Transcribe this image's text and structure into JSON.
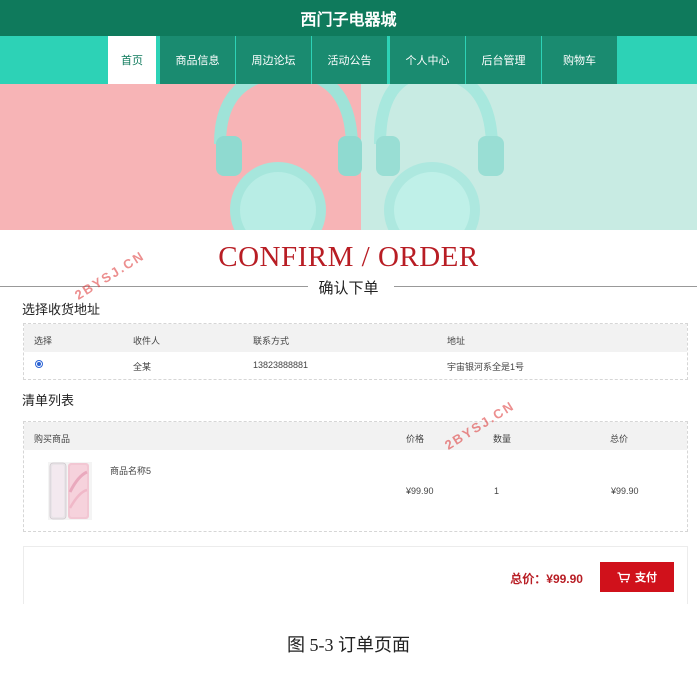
{
  "site_title": "西门子电器城",
  "nav": {
    "home": "首页",
    "products": "商品信息",
    "forum": "周边论坛",
    "announcements": "活动公告",
    "profile": "个人中心",
    "admin": "后台管理",
    "cart": "购物车"
  },
  "page_heading": {
    "title_en": "CONFIRM / ORDER",
    "title_cn": "确认下单"
  },
  "address_section": {
    "title": "选择收货地址",
    "headers": {
      "select": "选择",
      "recipient": "收件人",
      "contact": "联系方式",
      "address": "地址"
    },
    "row": {
      "recipient": "全某",
      "contact": "13823888881",
      "address": "宇宙银河系全是1号"
    }
  },
  "order_list": {
    "title": "清单列表",
    "headers": {
      "product": "购买商品",
      "price": "价格",
      "quantity": "数量",
      "subtotal": "总价"
    },
    "item": {
      "name": "商品名称5",
      "price": "¥99.90",
      "quantity": "1",
      "subtotal": "¥99.90"
    }
  },
  "payment": {
    "total_label": "总价：¥99.90",
    "pay_button": "支付"
  },
  "watermark": "2BYSJ.CN",
  "caption": "图 5-3 订单页面",
  "colors": {
    "header_green": "#0f7a5c",
    "nav_teal": "#2dd2b6",
    "accent_red": "#d0111b"
  }
}
